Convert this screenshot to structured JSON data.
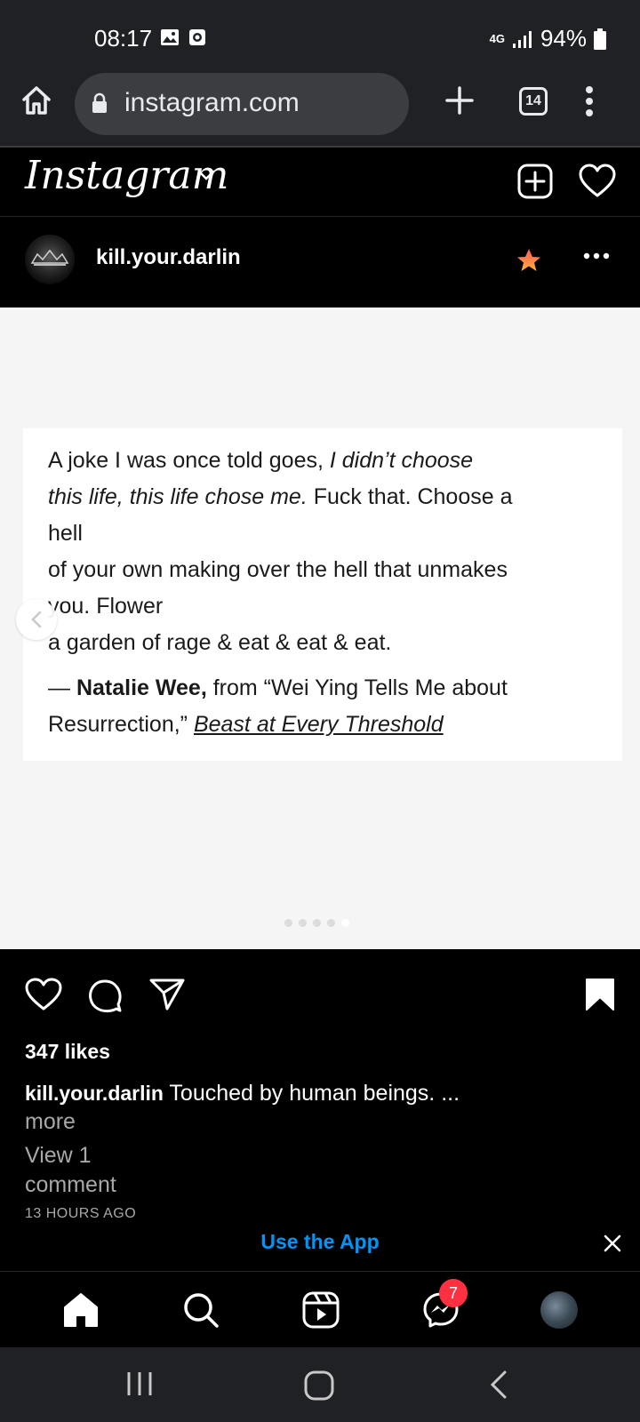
{
  "status_bar": {
    "time": "08:17",
    "network": "4G",
    "battery": "94%"
  },
  "browser": {
    "url": "instagram.com",
    "tab_count": "14"
  },
  "instagram": {
    "logo": "Instagram"
  },
  "post": {
    "username": "kill.your.darlin",
    "quote_lines": [
      {
        "plain_a": "A joke I was once told goes, ",
        "italic": "I didn’t choose",
        "plain_b": ""
      },
      {
        "plain_a": "",
        "italic": "this life, this life chose me.",
        "plain_b": " Fuck that. Choose a"
      },
      {
        "plain_a": "hell",
        "italic": "",
        "plain_b": ""
      },
      {
        "plain_a": "of your own making over the hell that unmakes",
        "italic": "",
        "plain_b": ""
      },
      {
        "plain_a": "you. Flower",
        "italic": "",
        "plain_b": ""
      },
      {
        "plain_a": "a garden of rage & eat & eat & eat.",
        "italic": "",
        "plain_b": ""
      }
    ],
    "attribution": {
      "dash": "— ",
      "author": "Natalie Wee,",
      "middle": " from “Wei Ying Tells Me about",
      "line2": "Resurrection,” ",
      "book": "Beast at Every Threshold"
    },
    "carousel": {
      "total": 5,
      "active_index": 4
    },
    "likes": "347 likes",
    "caption_user": "kill.your.darlin",
    "caption_text": " Touched by human beings. ...",
    "caption_more": "more",
    "view_comments": "View 1 comment",
    "time_ago": "13 HOURS AGO"
  },
  "banner": {
    "use_app": "Use the App"
  },
  "bottom_nav": {
    "messenger_badge": "7"
  },
  "colors": {
    "accent_blue": "#0095f6",
    "badge_red": "#ff3040",
    "browser_bg": "#202124"
  }
}
